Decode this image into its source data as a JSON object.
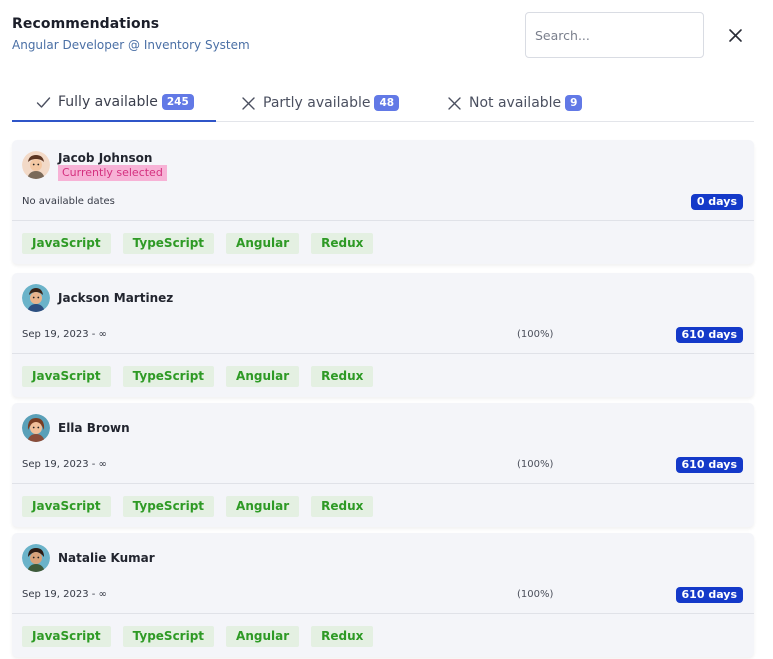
{
  "header": {
    "title": "Recommendations",
    "subtitle": "Angular Developer @ Inventory System"
  },
  "search": {
    "placeholder": "Search..."
  },
  "tabs": [
    {
      "label": "Fully available",
      "count": "245",
      "icon": "check-icon",
      "active": true
    },
    {
      "label": "Partly available",
      "count": "48",
      "icon": "x-icon",
      "active": false
    },
    {
      "label": "Not available",
      "count": "9",
      "icon": "x-icon",
      "active": false
    }
  ],
  "colors": {
    "accent": "#2f55c8",
    "count_badge": "#6279e6",
    "days_badge": "#1439c9",
    "skill_bg": "#e4f0e2",
    "skill_text": "#2e9a25",
    "selected_bg": "#f7b2d6",
    "selected_text": "#d4307f"
  },
  "candidates": [
    {
      "name": "Jacob Johnson",
      "selected_label": "Currently selected",
      "dates": "No available dates",
      "percent": "",
      "days": "0 days",
      "skills": [
        "JavaScript",
        "TypeScript",
        "Angular",
        "Redux"
      ]
    },
    {
      "name": "Jackson Martinez",
      "selected_label": "",
      "dates": "Sep 19, 2023 - ∞",
      "percent": "(100%)",
      "days": "610 days",
      "skills": [
        "JavaScript",
        "TypeScript",
        "Angular",
        "Redux"
      ]
    },
    {
      "name": "Ella Brown",
      "selected_label": "",
      "dates": "Sep 19, 2023 - ∞",
      "percent": "(100%)",
      "days": "610 days",
      "skills": [
        "JavaScript",
        "TypeScript",
        "Angular",
        "Redux"
      ]
    },
    {
      "name": "Natalie Kumar",
      "selected_label": "",
      "dates": "Sep 19, 2023 - ∞",
      "percent": "(100%)",
      "days": "610 days",
      "skills": [
        "JavaScript",
        "TypeScript",
        "Angular",
        "Redux"
      ]
    }
  ]
}
